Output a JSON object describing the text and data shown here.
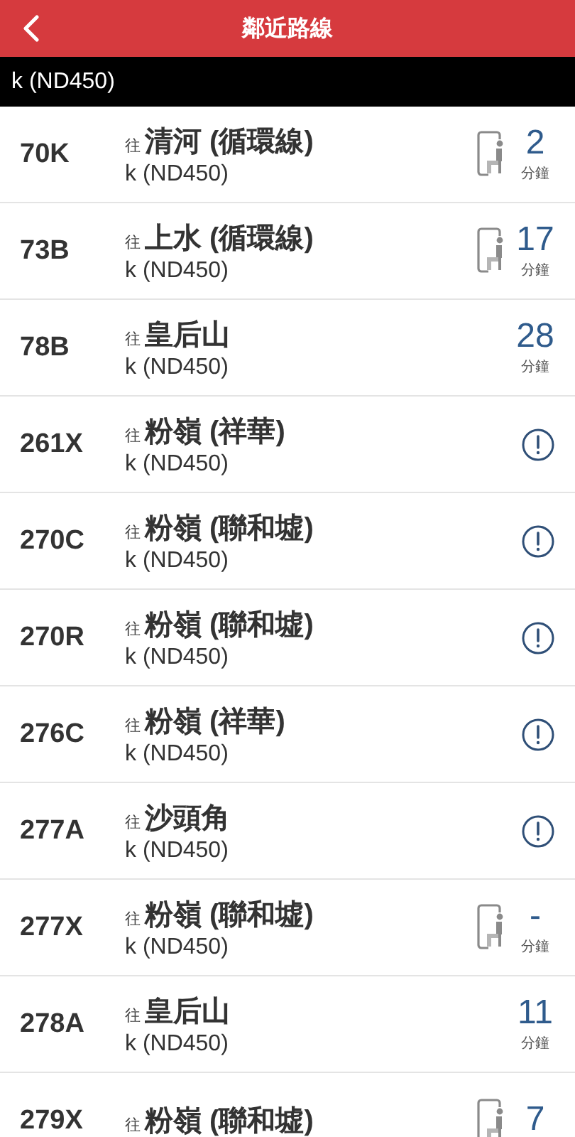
{
  "header": {
    "title": "鄰近路線"
  },
  "stop_bar": {
    "name": "k (ND450)"
  },
  "routes": [
    {
      "route": "70K",
      "prefix": "往",
      "destination": "清河 (循環線)",
      "stop": "k (ND450)",
      "kind": "time",
      "seat_icon": true,
      "eta": "2",
      "unit": "分鐘"
    },
    {
      "route": "73B",
      "prefix": "往",
      "destination": "上水 (循環線)",
      "stop": "k (ND450)",
      "kind": "time",
      "seat_icon": true,
      "eta": "17",
      "unit": "分鐘"
    },
    {
      "route": "78B",
      "prefix": "往",
      "destination": "皇后山",
      "stop": "k (ND450)",
      "kind": "time",
      "seat_icon": false,
      "eta": "28",
      "unit": "分鐘"
    },
    {
      "route": "261X",
      "prefix": "往",
      "destination": "粉嶺 (祥華)",
      "stop": "k (ND450)",
      "kind": "alert"
    },
    {
      "route": "270C",
      "prefix": "往",
      "destination": "粉嶺 (聯和墟)",
      "stop": "k (ND450)",
      "kind": "alert"
    },
    {
      "route": "270R",
      "prefix": "往",
      "destination": "粉嶺 (聯和墟)",
      "stop": "k (ND450)",
      "kind": "alert"
    },
    {
      "route": "276C",
      "prefix": "往",
      "destination": "粉嶺 (祥華)",
      "stop": "k (ND450)",
      "kind": "alert"
    },
    {
      "route": "277A",
      "prefix": "往",
      "destination": "沙頭角",
      "stop": "k (ND450)",
      "kind": "alert"
    },
    {
      "route": "277X",
      "prefix": "往",
      "destination": "粉嶺 (聯和墟)",
      "stop": "k (ND450)",
      "kind": "time",
      "seat_icon": true,
      "eta": "-",
      "unit": "分鐘"
    },
    {
      "route": "278A",
      "prefix": "往",
      "destination": "皇后山",
      "stop": "k (ND450)",
      "kind": "time",
      "seat_icon": false,
      "eta": "11",
      "unit": "分鐘"
    },
    {
      "route": "279X",
      "prefix": "往",
      "destination": "粉嶺 (聯和墟)",
      "kind": "time",
      "seat_icon": true,
      "eta": "7"
    }
  ]
}
